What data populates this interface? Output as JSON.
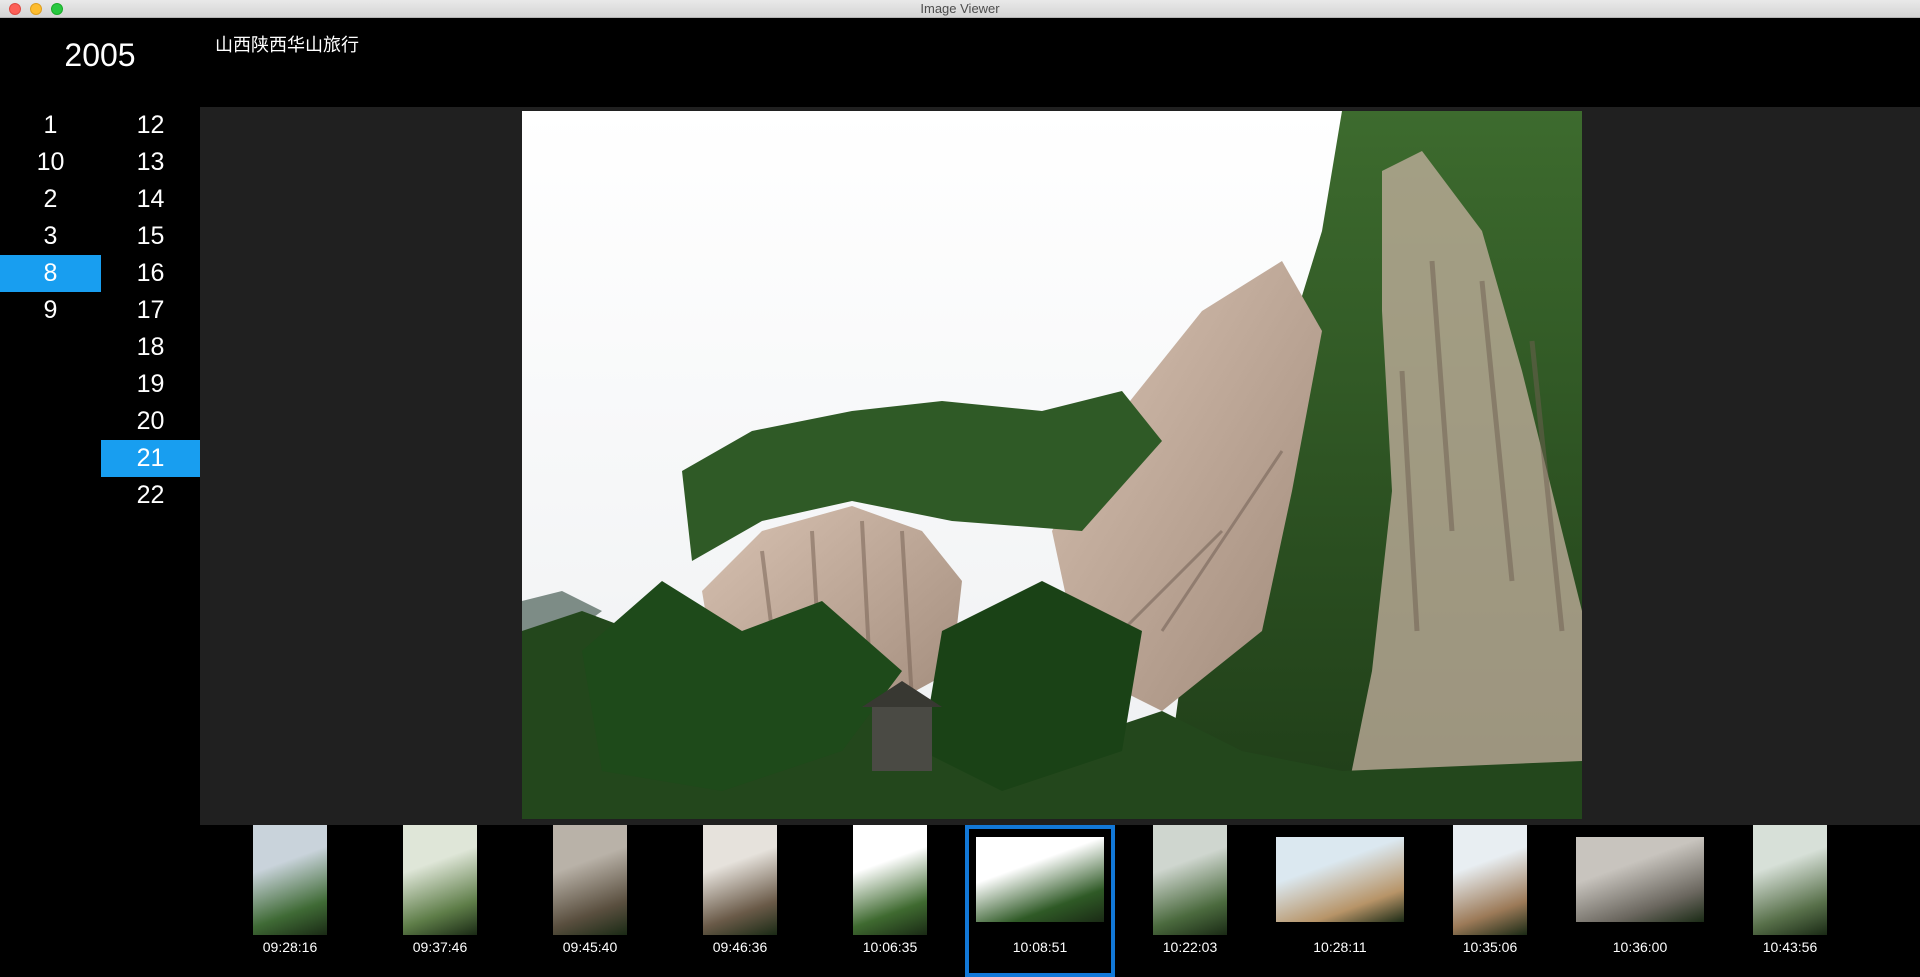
{
  "window": {
    "title": "Image Viewer"
  },
  "header": {
    "year": "2005",
    "album_title": "山西陕西华山旅行"
  },
  "months": [
    {
      "label": "1",
      "selected": false
    },
    {
      "label": "10",
      "selected": false
    },
    {
      "label": "2",
      "selected": false
    },
    {
      "label": "3",
      "selected": false
    },
    {
      "label": "8",
      "selected": true
    },
    {
      "label": "9",
      "selected": false
    }
  ],
  "days": [
    {
      "label": "12",
      "selected": false
    },
    {
      "label": "13",
      "selected": false
    },
    {
      "label": "14",
      "selected": false
    },
    {
      "label": "15",
      "selected": false
    },
    {
      "label": "16",
      "selected": false
    },
    {
      "label": "17",
      "selected": false
    },
    {
      "label": "18",
      "selected": false
    },
    {
      "label": "19",
      "selected": false
    },
    {
      "label": "20",
      "selected": false
    },
    {
      "label": "21",
      "selected": true
    },
    {
      "label": "22",
      "selected": false
    }
  ],
  "filmstrip": [
    {
      "time": "",
      "orientation": "partial",
      "selected": false
    },
    {
      "time": "09:28:16",
      "orientation": "portrait",
      "selected": false
    },
    {
      "time": "09:37:46",
      "orientation": "portrait",
      "selected": false
    },
    {
      "time": "09:45:40",
      "orientation": "portrait",
      "selected": false
    },
    {
      "time": "09:46:36",
      "orientation": "portrait",
      "selected": false
    },
    {
      "time": "10:06:35",
      "orientation": "portrait",
      "selected": false
    },
    {
      "time": "10:08:51",
      "orientation": "landscape",
      "selected": true
    },
    {
      "time": "10:22:03",
      "orientation": "portrait",
      "selected": false
    },
    {
      "time": "10:28:11",
      "orientation": "landscape",
      "selected": false
    },
    {
      "time": "10:35:06",
      "orientation": "portrait",
      "selected": false
    },
    {
      "time": "10:36:00",
      "orientation": "landscape",
      "selected": false
    },
    {
      "time": "10:43:56",
      "orientation": "portrait",
      "selected": false
    }
  ],
  "colors": {
    "selection": "#189ef0",
    "thumb_border": "#1278d8",
    "viewer_bg": "#202020"
  }
}
